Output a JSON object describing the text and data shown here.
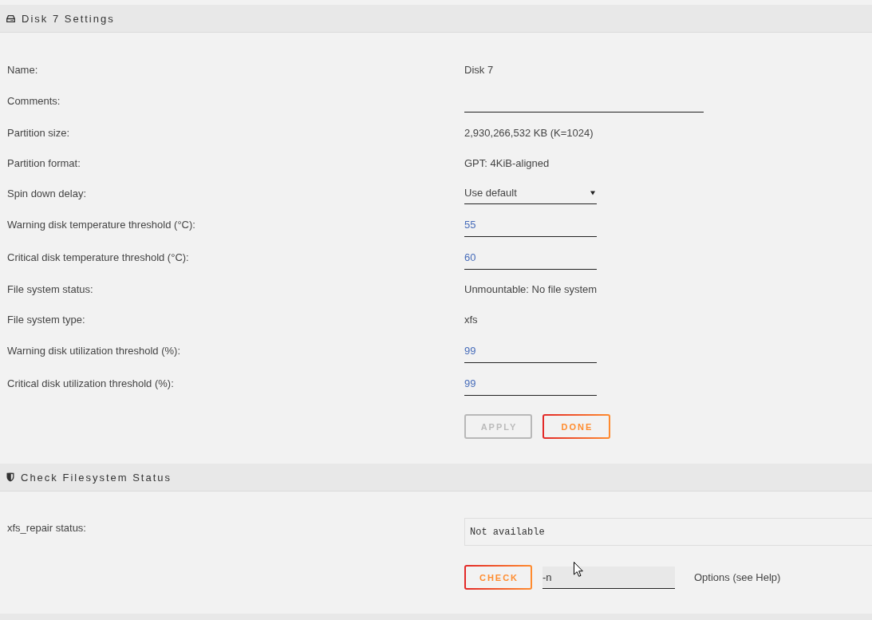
{
  "sections": [
    {
      "kind": "settings",
      "title": "Disk 7 Settings",
      "rows": [
        {
          "kind": "text",
          "label": "Name:",
          "value": "Disk 7"
        },
        {
          "kind": "comment",
          "label": "Comments:"
        },
        {
          "kind": "text",
          "label": "Partition size:",
          "value": "2,930,266,532 KB (K=1024)"
        },
        {
          "kind": "text",
          "label": "Partition format:",
          "value": "GPT: 4KiB-aligned"
        },
        {
          "kind": "select",
          "label": "Spin down delay:",
          "value": "Use default"
        },
        {
          "kind": "number",
          "label": "Warning disk temperature threshold (°C):",
          "value": "55"
        },
        {
          "kind": "number",
          "label": "Critical disk temperature threshold (°C):",
          "value": "60"
        },
        {
          "kind": "text",
          "label": "File system status:",
          "value": "Unmountable: No file system"
        },
        {
          "kind": "text",
          "label": "File system type:",
          "value": "xfs"
        },
        {
          "kind": "number",
          "label": "Warning disk utilization threshold (%):",
          "value": "99"
        },
        {
          "kind": "number",
          "label": "Critical disk utilization threshold (%):",
          "value": "99"
        }
      ],
      "actions": [
        {
          "kind": "button",
          "label": "APPLY",
          "disabled": true
        },
        {
          "kind": "button",
          "label": "DONE",
          "disabled": false
        }
      ]
    },
    {
      "kind": "check",
      "title": "Check Filesystem Status",
      "rows": [
        {
          "kind": "status",
          "label": "xfs_repair status:",
          "value": "Not available"
        }
      ],
      "actions": [
        {
          "kind": "button",
          "label": "CHECK",
          "disabled": false
        },
        {
          "kind": "input",
          "value": "-n"
        },
        {
          "kind": "hint",
          "text": "Options (see Help)"
        }
      ]
    }
  ]
}
